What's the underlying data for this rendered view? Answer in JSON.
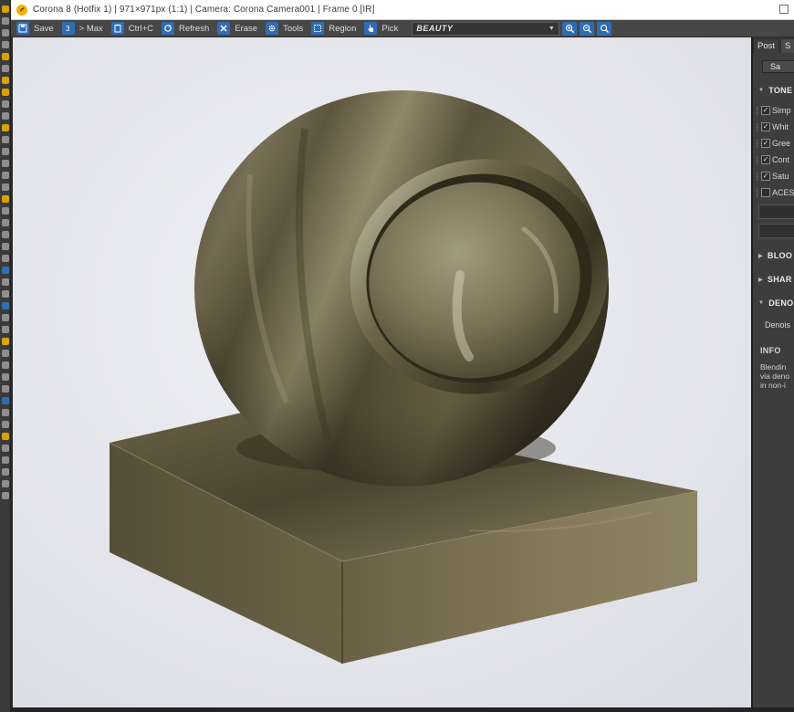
{
  "window": {
    "title": "Corona 8 (Hotfix 1) | 971×971px (1:1) | Camera: Corona Camera001 | Frame 0 [IR]"
  },
  "toolbar": {
    "save_label": "Save",
    "to_max_label": "> Max",
    "copy_label": "Ctrl+C",
    "refresh_label": "Refresh",
    "erase_label": "Erase",
    "tools_label": "Tools",
    "region_label": "Region",
    "pick_label": "Pick",
    "render_pass": "BEAUTY",
    "accent_color": "#2f6db3"
  },
  "side_panel": {
    "tabs": [
      "Post",
      "S"
    ],
    "save_label": "Sa",
    "tone_header": "TONE",
    "tone_options": [
      {
        "label": "Simp",
        "checked": true
      },
      {
        "label": "Whit",
        "checked": true
      },
      {
        "label": "Gree",
        "checked": true
      },
      {
        "label": "Cont",
        "checked": true
      },
      {
        "label": "Satu",
        "checked": true
      },
      {
        "label": "ACES",
        "checked": false
      }
    ],
    "bloom_header": "BLOO",
    "sharpen_header": "SHAR",
    "denoise_header": "DENO",
    "denoise_label": "Denois",
    "info_header": "INFO",
    "info_lines": [
      "Blendin",
      "via deno",
      "in non-i"
    ]
  },
  "render": {
    "subject": "metal shader-ball material preview",
    "background_color": "#e8e9ee",
    "metal_color": "#6b6146"
  }
}
